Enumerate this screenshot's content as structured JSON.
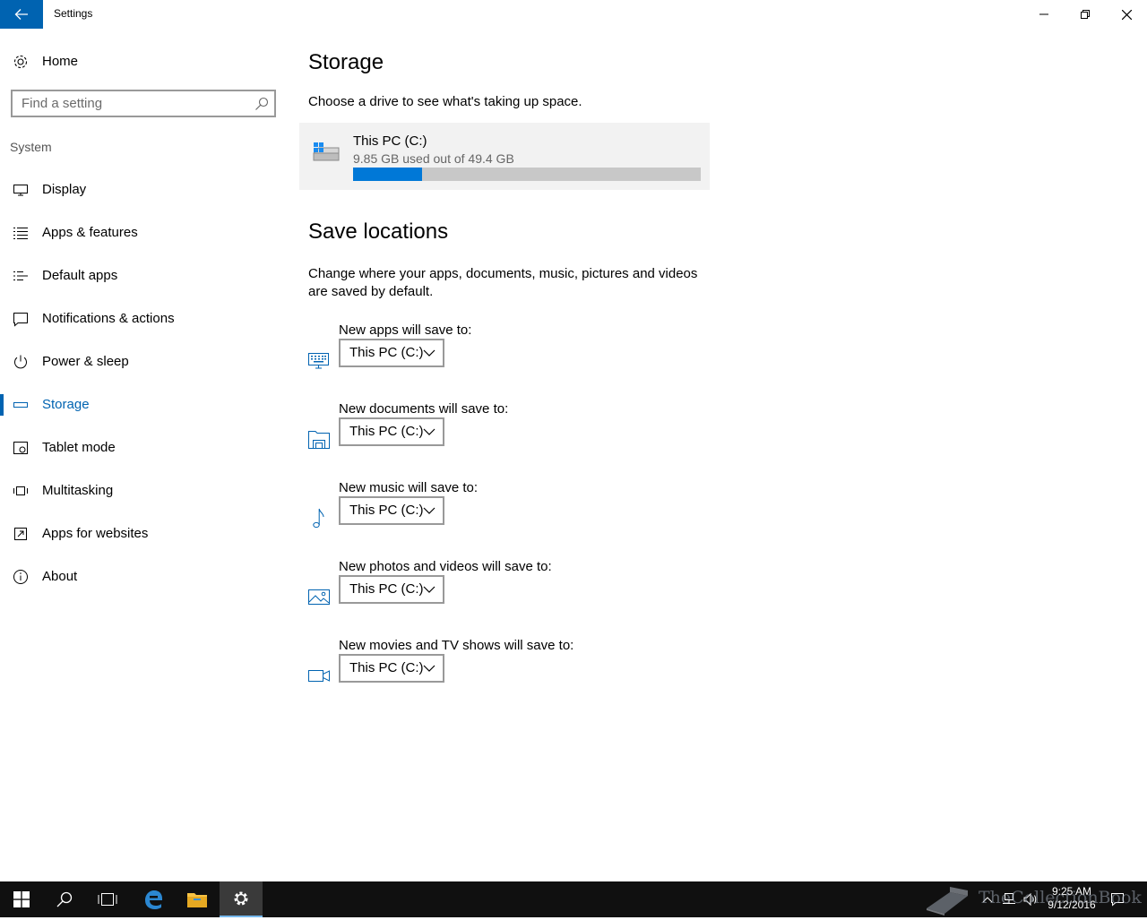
{
  "window": {
    "title": "Settings"
  },
  "sidebar": {
    "home_label": "Home",
    "search_placeholder": "Find a setting",
    "section_label": "System",
    "items": [
      {
        "label": "Display",
        "icon": "display-icon"
      },
      {
        "label": "Apps & features",
        "icon": "apps-features-icon"
      },
      {
        "label": "Default apps",
        "icon": "default-apps-icon"
      },
      {
        "label": "Notifications & actions",
        "icon": "notifications-icon"
      },
      {
        "label": "Power & sleep",
        "icon": "power-icon"
      },
      {
        "label": "Storage",
        "icon": "storage-icon",
        "active": true
      },
      {
        "label": "Tablet mode",
        "icon": "tablet-mode-icon"
      },
      {
        "label": "Multitasking",
        "icon": "multitasking-icon"
      },
      {
        "label": "Apps for websites",
        "icon": "apps-websites-icon"
      },
      {
        "label": "About",
        "icon": "info-icon"
      }
    ]
  },
  "main": {
    "title": "Storage",
    "description": "Choose a drive to see what's taking up space.",
    "drive": {
      "name": "This PC (C:)",
      "usage": "9.85 GB used out of 49.4 GB",
      "used_fraction": 0.1994
    },
    "save_locations_title": "Save locations",
    "save_locations_description": "Change where your apps, documents, music, pictures and videos are saved by default.",
    "locations": [
      {
        "label": "New apps will save to:",
        "value": "This PC (C:)",
        "icon": "keyboard-monitor-icon"
      },
      {
        "label": "New documents will save to:",
        "value": "This PC (C:)",
        "icon": "documents-icon"
      },
      {
        "label": "New music will save to:",
        "value": "This PC (C:)",
        "icon": "music-note-icon"
      },
      {
        "label": "New photos and videos will save to:",
        "value": "This PC (C:)",
        "icon": "picture-icon"
      },
      {
        "label": "New movies and TV shows will save to:",
        "value": "This PC (C:)",
        "icon": "video-camera-icon"
      }
    ]
  },
  "taskbar": {
    "time": "9:25 AM",
    "date": "9/12/2016",
    "watermark": "TheCollectionBook"
  },
  "colors": {
    "accent": "#0063b1",
    "progress": "#0078d7",
    "taskbar": "#101010"
  }
}
